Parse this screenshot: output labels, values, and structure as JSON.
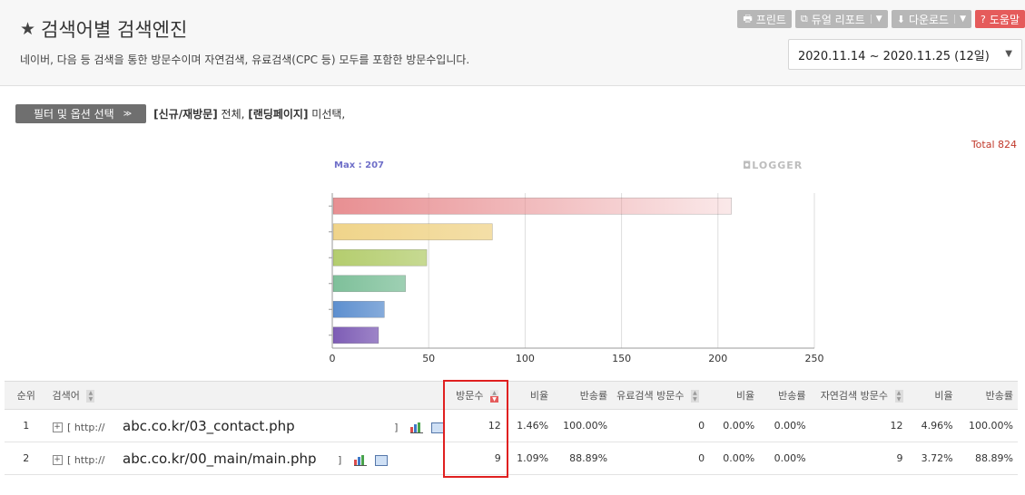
{
  "header": {
    "title": "검색어별 검색엔진",
    "subtitle": "네이버, 다음 등 검색을 통한 방문수이며 자연검색, 유료검색(CPC 등) 모두를 포함한 방문수입니다.",
    "buttons": {
      "print": "프린트",
      "dual_report": "듀얼 리포트",
      "download": "다운로드",
      "help": "도움말"
    },
    "date_range": "2020.11.14 ~ 2020.11.25 (12일)"
  },
  "filter": {
    "button_label": "필터 및 옵션 선택",
    "new_return_label": "[신규/재방문]",
    "new_return_value": "전체,",
    "landing_label": "[랜딩페이지]",
    "landing_value": "미선택,"
  },
  "total": "Total 824",
  "chart_data": {
    "type": "bar",
    "orientation": "horizontal",
    "max_label": "Max : 207",
    "watermark": "LOGGER",
    "categories": [
      "",
      "",
      "",
      "",
      "",
      ""
    ],
    "values": [
      207,
      83,
      49,
      38,
      27,
      24
    ],
    "colors": [
      "#e88f92",
      "#f0d48a",
      "#b4cd6e",
      "#7ec09a",
      "#5d8fcf",
      "#7d5cb5"
    ],
    "xlim": [
      0,
      250
    ],
    "xticks": [
      0,
      50,
      100,
      150,
      200,
      250
    ],
    "grid": true
  },
  "table": {
    "columns": [
      "순위",
      "검색어",
      "방문수",
      "비율",
      "반송률",
      "유료검색 방문수",
      "비율",
      "반송률",
      "자연검색 방문수",
      "비율",
      "반송률"
    ],
    "rows": [
      {
        "rank": "1",
        "url_prefix": "[ http://",
        "url": "abc.co.kr/03_contact.php",
        "url_suffix": "]",
        "visits": "12",
        "ratio": "1.46%",
        "bounce": "100.00%",
        "paid_visits": "0",
        "paid_ratio": "0.00%",
        "paid_bounce": "0.00%",
        "organic_visits": "12",
        "organic_ratio": "4.96%",
        "organic_bounce": "100.00%"
      },
      {
        "rank": "2",
        "url_prefix": "[ http://",
        "url": "abc.co.kr/00_main/main.php",
        "url_suffix": "]",
        "visits": "9",
        "ratio": "1.09%",
        "bounce": "88.89%",
        "paid_visits": "0",
        "paid_ratio": "0.00%",
        "paid_bounce": "0.00%",
        "organic_visits": "9",
        "organic_ratio": "3.72%",
        "organic_bounce": "88.89%"
      }
    ]
  }
}
